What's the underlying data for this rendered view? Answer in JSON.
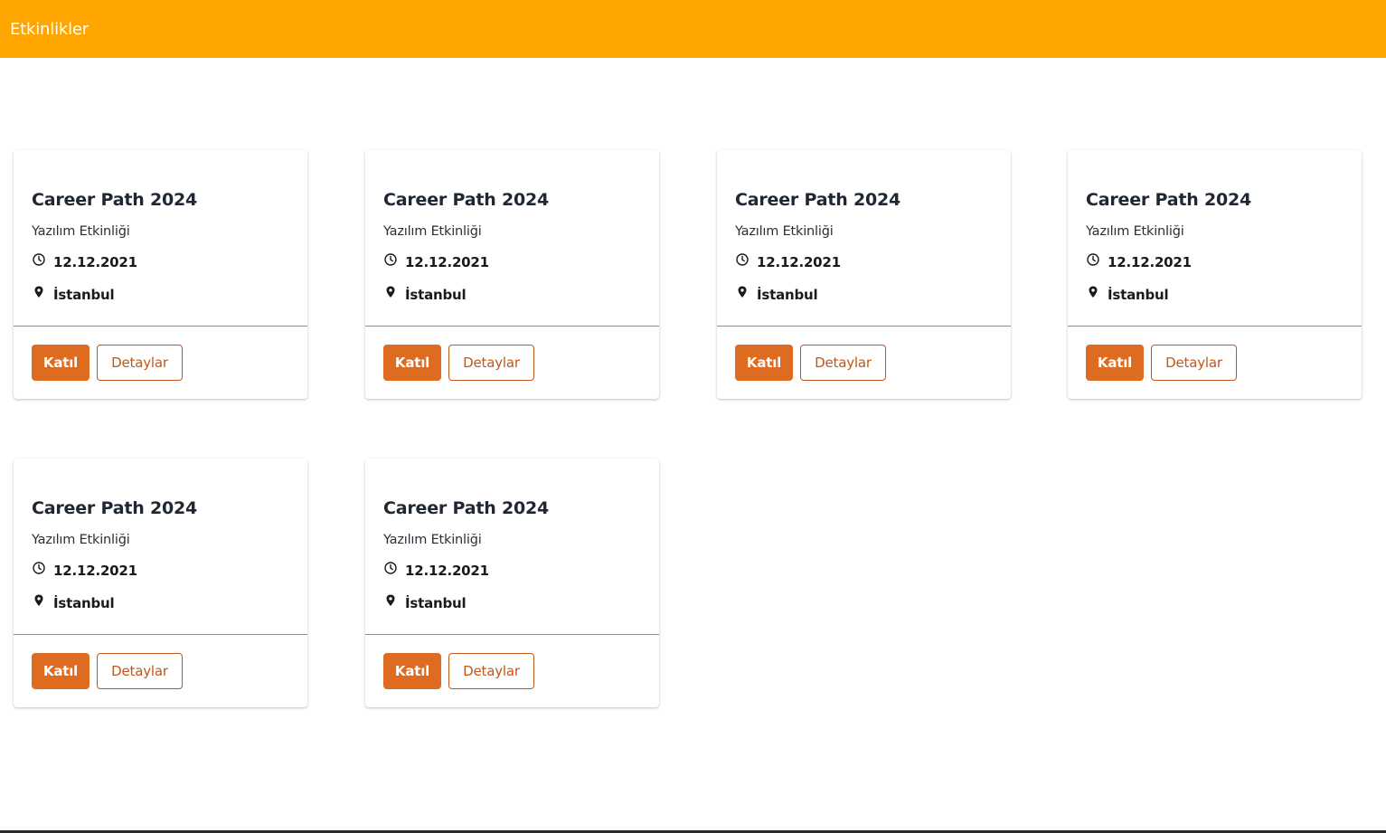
{
  "header": {
    "title": "Etkinlikler",
    "background": "#FFA500"
  },
  "events": [
    {
      "title": "Career Path 2024",
      "subtitle": "Yazılım Etkinliği",
      "date": "12.12.2021",
      "location": "İstanbul",
      "join_label": "Katıl",
      "details_label": "Detaylar"
    },
    {
      "title": "Career Path 2024",
      "subtitle": "Yazılım Etkinliği",
      "date": "12.12.2021",
      "location": "İstanbul",
      "join_label": "Katıl",
      "details_label": "Detaylar"
    },
    {
      "title": "Career Path 2024",
      "subtitle": "Yazılım Etkinliği",
      "date": "12.12.2021",
      "location": "İstanbul",
      "join_label": "Katıl",
      "details_label": "Detaylar"
    },
    {
      "title": "Career Path 2024",
      "subtitle": "Yazılım Etkinliği",
      "date": "12.12.2021",
      "location": "İstanbul",
      "join_label": "Katıl",
      "details_label": "Detaylar"
    },
    {
      "title": "Career Path 2024",
      "subtitle": "Yazılım Etkinliği",
      "date": "12.12.2021",
      "location": "İstanbul",
      "join_label": "Katıl",
      "details_label": "Detaylar"
    },
    {
      "title": "Career Path 2024",
      "subtitle": "Yazılım Etkinliği",
      "date": "12.12.2021",
      "location": "İstanbul",
      "join_label": "Katıl",
      "details_label": "Detaylar"
    }
  ],
  "icons": {
    "date": "clock-icon",
    "location": "map-pin-icon"
  },
  "colors": {
    "accent": "#DD6B20",
    "outline": "#C0571A"
  }
}
